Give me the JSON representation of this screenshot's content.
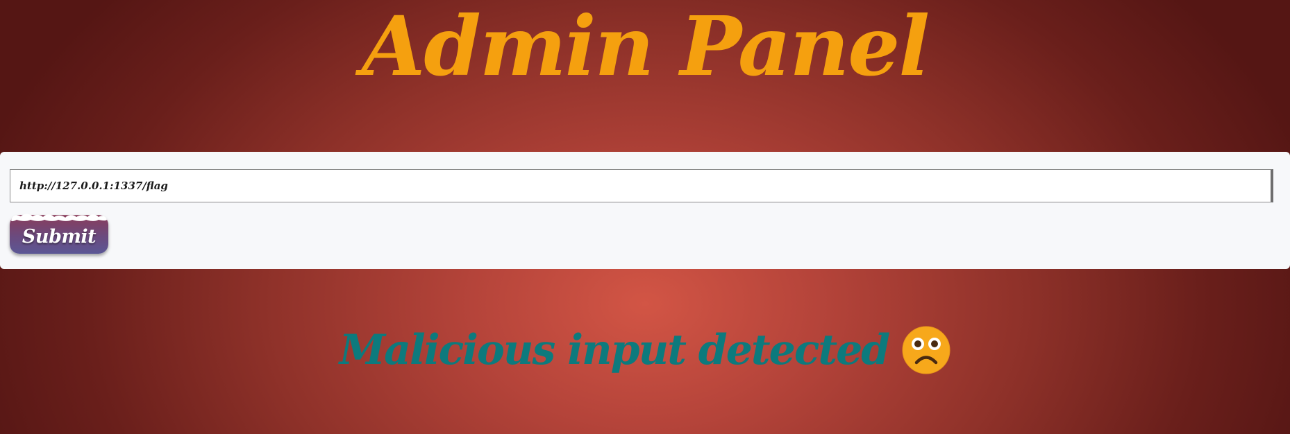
{
  "header": {
    "title": "Admin Panel"
  },
  "form": {
    "url_value": "http://127.0.0.1:1337/flag",
    "submit_label": "Submit"
  },
  "result": {
    "message": "Malicious input detected",
    "icon": "sad-face-icon"
  },
  "colors": {
    "title": "#f5a00f",
    "message": "#0d7a7d",
    "panel": "#f7f8fa",
    "background": "#b5443a",
    "button": "#6b4a7e"
  }
}
